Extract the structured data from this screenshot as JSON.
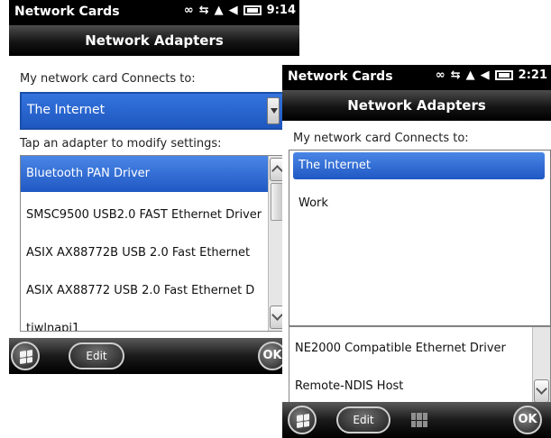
{
  "left": {
    "status": {
      "title": "Network Cards",
      "time": "9:14"
    },
    "header": {
      "title": "Network Adapters"
    },
    "connects_label": "My network card Connects to:",
    "connects_value": "The Internet",
    "adapters_label": "Tap an adapter to modify settings:",
    "adapters": [
      "Bluetooth PAN Driver",
      "SMSC9500 USB2.0 FAST Ethernet Driver",
      "ASIX AX88772B USB 2.0 Fast Ethernet",
      "ASIX AX88772 USB 2.0 Fast Ethernet D",
      "tiwlnapi1"
    ],
    "bottom": {
      "edit_label": "Edit",
      "ok_label": "OK"
    }
  },
  "right": {
    "status": {
      "title": "Network Cards",
      "time": "2:21"
    },
    "header": {
      "title": "Network Adapters"
    },
    "connects_label": "My network card Connects to:",
    "dropdown_options": [
      "The Internet",
      "Work"
    ],
    "adapters": [
      "NE2000 Compatible Ethernet Driver",
      "Remote-NDIS Host"
    ],
    "bottom": {
      "edit_label": "Edit",
      "ok_label": "OK"
    }
  },
  "icons": {
    "status": [
      "link-icon",
      "sync-icon",
      "signal-icon",
      "speaker-icon",
      "battery-icon"
    ],
    "start": "windows-start-icon",
    "keyboard": "keyboard-icon"
  },
  "colors": {
    "accent_blue": "#1f58c3",
    "bar_black": "#000000"
  }
}
